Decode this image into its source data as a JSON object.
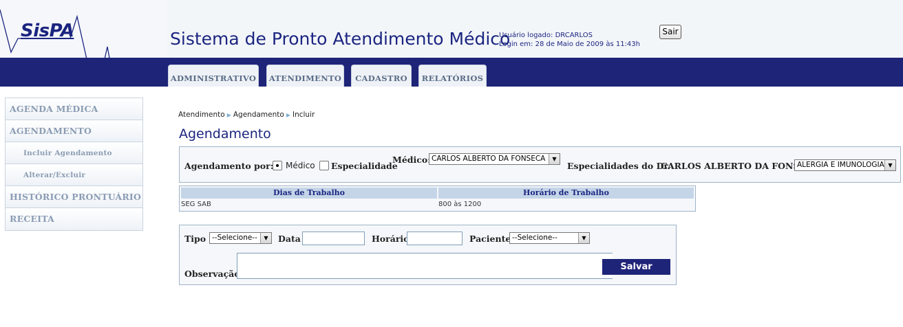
{
  "header": {
    "logo": "SisPA",
    "title": "Sistema de Pronto Atendimento Médico",
    "user_line": "Usuário logado: DRCARLOS",
    "login_line": "Login em: 28 de Maio de 2009 às 11:43h",
    "logout_label": "Sair"
  },
  "nav": {
    "tabs": [
      "ADMINISTRATIVO",
      "ATENDIMENTO",
      "CADASTRO",
      "RELATÓRIOS"
    ]
  },
  "sidebar": {
    "items": [
      "AGENDA MÉDICA",
      "AGENDAMENTO",
      "Incluir Agendamento",
      "Alterar/Excluir",
      "HISTÓRICO PRONTUÁRIO",
      "RECEITA"
    ]
  },
  "breadcrumb": [
    "Atendimento",
    "Agendamento",
    "Incluir"
  ],
  "page_title": "Agendamento",
  "agendamento_panel": {
    "por_label": "Agendamento por:",
    "radio_medico": "Médico",
    "radio_especialidade": "Especialidade",
    "medico_label": "Médico:",
    "medico_value": "CARLOS ALBERTO DA FONSECA",
    "especialidades_label": "Especialidades do Dr.",
    "doctor_name": "CARLOS ALBERTO DA FONSECA",
    "especialidade_value": "ALERGIA E IMUNOLOGIA"
  },
  "work_table": {
    "headers": [
      "Dias de Trabalho",
      "Horário de Trabalho"
    ],
    "row": [
      "SEG SAB",
      "800 às 1200"
    ]
  },
  "form": {
    "tipo_label": "Tipo",
    "tipo_value": "--Selecione--",
    "data_label": "Data",
    "data_value": "",
    "horario_label": "Horário",
    "horario_value": "",
    "paciente_label": "Paciente",
    "paciente_value": "--Selecione--",
    "observacao_label": "Observação",
    "observacao_value": "",
    "save_label": "Salvar"
  },
  "colors": {
    "nav_bg": "#1e2478",
    "title_color": "#1b2580",
    "panel_border": "#9fb3c8"
  }
}
